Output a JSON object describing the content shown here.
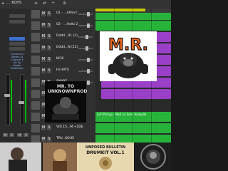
{
  "topbar": {
    "region_name": "... KOHS"
  },
  "inspector": {
    "plugins_lines": [
      "Enhanced",
      "Stereo St",
      "Channel E",
      "AU Up",
      "Limiter",
      "MultiMeter"
    ]
  },
  "tracks": [
    {
      "name": "01 - ...Ahhh!!"
    },
    {
      "name": "02 - ...Hello 2"
    },
    {
      "name": "Dddd...01 (2)"
    },
    {
      "name": "Dddd...N (12)"
    },
    {
      "name": "KICK"
    },
    {
      "name": "HI HATS"
    },
    {
      "name": "SNARE"
    },
    {
      "name": "808"
    },
    {
      "name": "LORD...5 Bpm"
    },
    {
      "name": "04 Cyt"
    },
    {
      "name": "VID 15...M.+1Db"
    },
    {
      "name": "TRV...KOHS"
    }
  ],
  "arrange": {
    "region_label": "LoFi Pickup - Mp3 Lo Sons Acapella"
  },
  "logo": {
    "text": "M.R."
  },
  "album": {
    "title": "MR. TO UNKNOWNPROD"
  },
  "bottom": {
    "drumkit_title_1": "UNPOSED BULLETIN",
    "drumkit_title_2": "DRUMKIT VOL.1"
  },
  "colors": {
    "region_green": "#27b33a",
    "region_purple": "#9a3fc7",
    "cycle": "#c9c900"
  }
}
